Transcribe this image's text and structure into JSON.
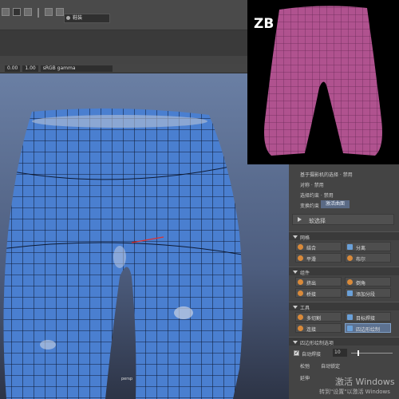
{
  "top_toolbar": {
    "workspace_dropdown": "鞋装"
  },
  "viewport_toolbar": {
    "field_value_1": "0.00",
    "field_value_2": "1.00",
    "color_space": "sRGB gamma"
  },
  "viewport": {
    "camera_label": "persp"
  },
  "zbrush_inset": {
    "label": "ZB"
  },
  "right_panel": {
    "rows": [
      {
        "label": "基于摄影机的选择 · 禁用"
      },
      {
        "label": "对称 · 禁用"
      },
      {
        "label": "选择约束 · 禁用"
      }
    ],
    "transform_constraint_label": "变换约束",
    "transform_constraint_value": "激活曲面",
    "soft_select_label": "软选择",
    "sections": {
      "mesh": {
        "title": "网格",
        "tools": [
          "结合",
          "分离",
          "平滑",
          "布尔"
        ]
      },
      "components": {
        "title": "组件",
        "tools": [
          "挤出",
          "倒角",
          "桥接",
          "添加分段"
        ]
      },
      "tools": {
        "title": "工具",
        "tools": [
          "多切割",
          "目标焊接",
          "连接",
          "四边形绘制"
        ]
      },
      "quad_draw": {
        "title": "四边形绘制选项"
      }
    },
    "auto_weld_label": "自动焊接",
    "auto_weld_value": "10",
    "snap_label": "松弛",
    "snap_value": "自动锁定",
    "extend_label": "延伸"
  },
  "watermark": {
    "line1": "激活 Windows",
    "line2": "转到\"设置\"以激活 Windows"
  },
  "colors": {
    "mesh_blue": "#4a7fd0",
    "zb_mesh_pink": "#b0528f",
    "panel_bg": "#444444",
    "accent_active": "#5c7190"
  }
}
